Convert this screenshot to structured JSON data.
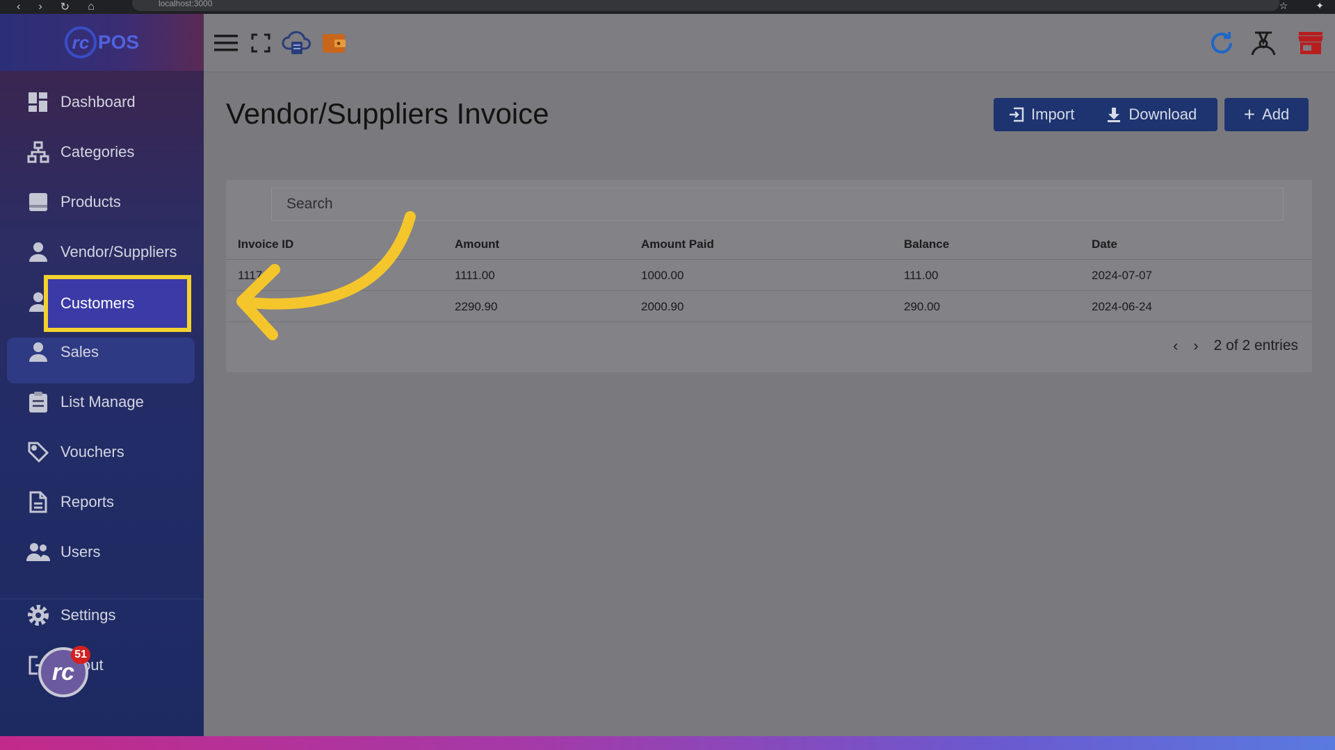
{
  "browser": {
    "url": "localhost:3000"
  },
  "brand": {
    "logo_text": "POS"
  },
  "sidebar": {
    "items": [
      {
        "label": "Dashboard",
        "icon": "dashboard-icon"
      },
      {
        "label": "Categories",
        "icon": "sitemap-icon"
      },
      {
        "label": "Products",
        "icon": "product-icon"
      },
      {
        "label": "Vendor/Suppliers",
        "icon": "person-icon"
      },
      {
        "label": "Customers",
        "icon": "person-icon",
        "active": true
      },
      {
        "label": "Sales",
        "icon": "person-icon"
      },
      {
        "label": "List Manage",
        "icon": "clipboard-icon"
      },
      {
        "label": "Vouchers",
        "icon": "tag-icon"
      },
      {
        "label": "Reports",
        "icon": "document-icon"
      },
      {
        "label": "Users",
        "icon": "users-icon"
      },
      {
        "label": "Settings",
        "icon": "gear-icon"
      },
      {
        "label": "Logout",
        "icon": "logout-icon",
        "visible_text": "out"
      }
    ]
  },
  "floating": {
    "badge": "51"
  },
  "page": {
    "title": "Vendor/Suppliers Invoice",
    "buttons": {
      "import": "Import",
      "download": "Download",
      "add": "Add"
    }
  },
  "search": {
    "placeholder": "Search"
  },
  "table": {
    "columns": [
      "Invoice ID",
      "Amount",
      "Amount Paid",
      "Balance",
      "Date"
    ],
    "rows": [
      {
        "invoice_id": "1117",
        "amount": "1111.00",
        "paid": "1000.00",
        "balance": "111.00",
        "date": "2024-07-07"
      },
      {
        "invoice_id": "",
        "amount": "2290.90",
        "paid": "2000.90",
        "balance": "290.00",
        "date": "2024-06-24"
      }
    ]
  },
  "pagination": {
    "summary": "2 of 2 entries"
  },
  "colors": {
    "accent": "#1d3470",
    "highlight": "#f4d22e",
    "badge": "#d32020"
  }
}
